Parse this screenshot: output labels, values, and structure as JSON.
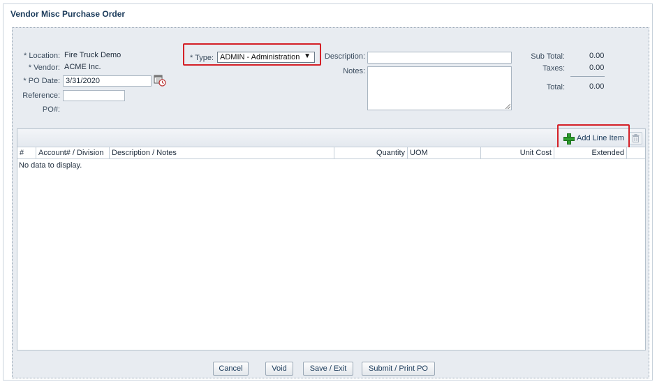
{
  "window": {
    "title": "Vendor Misc Purchase Order"
  },
  "form": {
    "location_label": "* Location:",
    "location_value": "Fire Truck Demo",
    "vendor_label": "* Vendor:",
    "vendor_value": "ACME Inc.",
    "po_date_label": "* PO Date:",
    "po_date_value": "3/31/2020",
    "reference_label": "Reference:",
    "reference_value": "",
    "po_number_label": "PO#:",
    "type_label": "* Type:",
    "type_value": "ADMIN - Administration",
    "description_label": "Description:",
    "description_value": "",
    "notes_label": "Notes:",
    "notes_value": ""
  },
  "totals": {
    "subtotal_label": "Sub Total:",
    "subtotal_value": "0.00",
    "taxes_label": "Taxes:",
    "taxes_value": "0.00",
    "total_label": "Total:",
    "total_value": "0.00"
  },
  "grid": {
    "add_line_item_label": "Add Line Item",
    "columns": [
      "#",
      "Account# / Division",
      "Description / Notes",
      "Quantity",
      "UOM",
      "Unit Cost",
      "Extended"
    ],
    "empty_text": "No data to display."
  },
  "buttons": {
    "cancel": "Cancel",
    "void": "Void",
    "save_exit": "Save / Exit",
    "submit_print": "Submit / Print PO"
  },
  "colors": {
    "highlight": "#d42027",
    "panel_bg": "#e8ecf1",
    "accent": "#2e9e2e"
  }
}
